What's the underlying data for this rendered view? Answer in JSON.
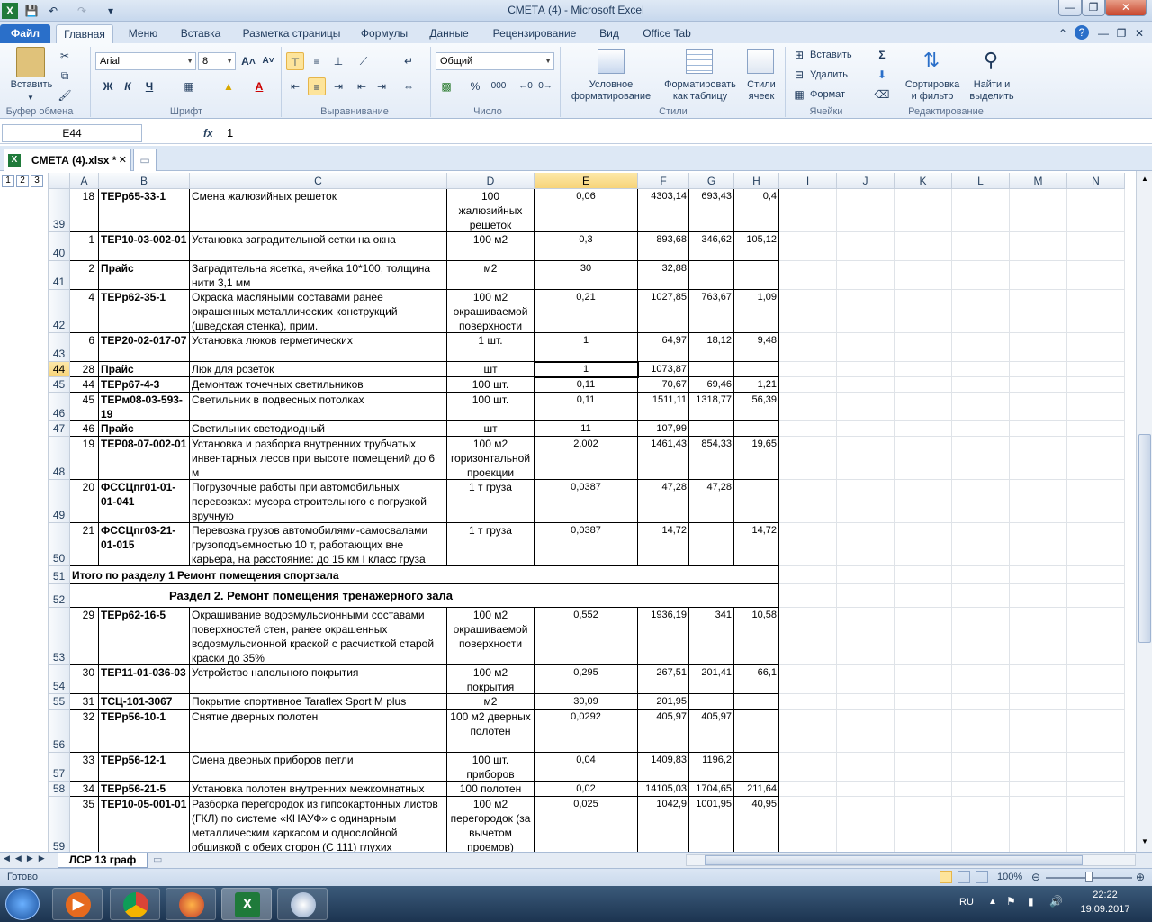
{
  "window": {
    "title": "СМЕТА (4)  -  Microsoft Excel"
  },
  "ribbon_tabs": [
    "Файл",
    "Главная",
    "Меню",
    "Вставка",
    "Разметка страницы",
    "Формулы",
    "Данные",
    "Рецензирование",
    "Вид",
    "Office Tab"
  ],
  "ribbon": {
    "paste_label": "Вставить",
    "font_name": "Arial",
    "font_size": "8",
    "bold": "Ж",
    "italic": "К",
    "underline": "Ч",
    "number_format": "Общий",
    "percent": "%",
    "thousands": "000",
    "conditional_line1": "Условное",
    "conditional_line2": "форматирование",
    "format_table_line1": "Форматировать",
    "format_table_line2": "как таблицу",
    "cell_styles_line1": "Стили",
    "cell_styles_line2": "ячеек",
    "insert": "Вставить",
    "delete": "Удалить",
    "format": "Формат",
    "sort_line1": "Сортировка",
    "sort_line2": "и фильтр",
    "find_line1": "Найти и",
    "find_line2": "выделить",
    "groups": {
      "clipboard": "Буфер обмена",
      "font": "Шрифт",
      "alignment": "Выравнивание",
      "number": "Число",
      "styles": "Стили",
      "cells": "Ячейки",
      "editing": "Редактирование"
    }
  },
  "formula_bar": {
    "cell_ref": "E44",
    "fx": "fx",
    "value": "1"
  },
  "office_tab": {
    "doc_name": "СМЕТА (4).xlsx *"
  },
  "outline_levels": [
    "1",
    "2",
    "3"
  ],
  "columns": [
    "A",
    "B",
    "C",
    "D",
    "E",
    "F",
    "G",
    "H",
    "I",
    "J",
    "K",
    "L",
    "M",
    "N"
  ],
  "rows": [
    {
      "num": "39",
      "a": "18",
      "b": "ТЕРр65-33-1",
      "c": "Смена жалюзийных решеток",
      "d": "100 жалюзийных решеток",
      "e": "0,06",
      "f": "4303,14",
      "g": "693,43",
      "h": "0,4"
    },
    {
      "num": "40",
      "a": "1",
      "b": "ТЕР10-03-002-01",
      "c": "Установка заградительной сетки на окна",
      "d": "100 м2",
      "e": "0,3",
      "f": "893,68",
      "g": "346,62",
      "h": "105,12"
    },
    {
      "num": "41",
      "a": "2",
      "b": "Прайс",
      "c": "Заградительна ясетка, ячейка 10*100, толщина нити 3,1 мм",
      "d": "м2",
      "e": "30",
      "f": "32,88",
      "g": "",
      "h": ""
    },
    {
      "num": "42",
      "a": "4",
      "b": "ТЕРр62-35-1",
      "c": "Окраска масляными составами ранее окрашенных металлических конструкций (шведская стенка), прим.",
      "d": "100 м2 окрашиваемой поверхности",
      "e": "0,21",
      "f": "1027,85",
      "g": "763,67",
      "h": "1,09"
    },
    {
      "num": "43",
      "a": "6",
      "b": "ТЕР20-02-017-07",
      "c": "Установка люков герметических",
      "d": "1 шт.",
      "e": "1",
      "f": "64,97",
      "g": "18,12",
      "h": "9,48"
    },
    {
      "num": "44",
      "a": "28",
      "b": "Прайс",
      "c": "Люк для розеток",
      "d": "шт",
      "e": "1",
      "f": "1073,87",
      "g": "",
      "h": ""
    },
    {
      "num": "45",
      "a": "44",
      "b": "ТЕРр67-4-3",
      "c": "Демонтаж точечных  светильников",
      "d": "100 шт.",
      "e": "0,11",
      "f": "70,67",
      "g": "69,46",
      "h": "1,21"
    },
    {
      "num": "46",
      "a": "45",
      "b": "ТЕРм08-03-593-19",
      "c": "Светильник в подвесных потолках",
      "d": "100 шт.",
      "e": "0,11",
      "f": "1511,11",
      "g": "1318,77",
      "h": "56,39"
    },
    {
      "num": "47",
      "a": "46",
      "b": "Прайс",
      "c": "Светильник светодиодный",
      "d": "шт",
      "e": "11",
      "f": "107,99",
      "g": "",
      "h": ""
    },
    {
      "num": "48",
      "a": "19",
      "b": "ТЕР08-07-002-01",
      "c": "Установка и разборка внутренних трубчатых инвентарных лесов при высоте помещений до 6 м",
      "d": "100 м2 горизонтальной проекции",
      "e": "2,002",
      "f": "1461,43",
      "g": "854,33",
      "h": "19,65"
    },
    {
      "num": "49",
      "a": "20",
      "b": "ФССЦпг01-01-01-041",
      "c": "Погрузочные работы при автомобильных перевозках: мусора строительного с погрузкой вручную",
      "d": "1 т груза",
      "e": "0,0387",
      "f": "47,28",
      "g": "47,28",
      "h": ""
    },
    {
      "num": "50",
      "a": "21",
      "b": "ФССЦпг03-21-01-015",
      "c": "Перевозка грузов автомобилями-самосвалами грузоподъемностью 10 т, работающих вне карьера, на расстояние: до 15 км I класс груза",
      "d": "1 т груза",
      "e": "0,0387",
      "f": "14,72",
      "g": "",
      "h": "14,72"
    },
    {
      "num": "51",
      "section": "Итого по разделу 1 Ремонт помещения спортзала"
    },
    {
      "num": "52",
      "section": "Раздел 2. Ремонт помещения тренажерного зала"
    },
    {
      "num": "53",
      "a": "29",
      "b": "ТЕРр62-16-5",
      "c": "Окрашивание водоэмульсионными составами поверхностей стен, ранее окрашенных водоэмульсионной краской с расчисткой старой краски до 35%",
      "d": "100 м2 окрашиваемой поверхности",
      "e": "0,552",
      "f": "1936,19",
      "g": "341",
      "h": "10,58"
    },
    {
      "num": "54",
      "a": "30",
      "b": "ТЕР11-01-036-03",
      "c": "Устройство напольного покрытия",
      "d": "100 м2 покрытия",
      "e": "0,295",
      "f": "267,51",
      "g": "201,41",
      "h": "66,1"
    },
    {
      "num": "55",
      "a": "31",
      "b": "ТСЦ-101-3067",
      "c": "Покрытие спортивное Taraflex Sport M plus",
      "d": "м2",
      "e": "30,09",
      "f": "201,95",
      "g": "",
      "h": ""
    },
    {
      "num": "56",
      "a": "32",
      "b": "ТЕРр56-10-1",
      "c": "Снятие дверных полотен",
      "d": "100 м2 дверных полотен",
      "e": "0,0292",
      "f": "405,97",
      "g": "405,97",
      "h": ""
    },
    {
      "num": "57",
      "a": "33",
      "b": "ТЕРр56-12-1",
      "c": "Смена дверных приборов петли",
      "d": "100 шт. приборов",
      "e": "0,04",
      "f": "1409,83",
      "g": "1196,2",
      "h": ""
    },
    {
      "num": "58",
      "a": "34",
      "b": "ТЕРр56-21-5",
      "c": "Установка полотен внутренних межкомнатных",
      "d": "100 полотен",
      "e": "0,02",
      "f": "14105,03",
      "g": "1704,65",
      "h": "211,64"
    },
    {
      "num": "59",
      "a": "35",
      "b": "ТЕР10-05-001-01",
      "c": "Разборка перегородок из гипсокартонных листов (ГКЛ) по системе «КНАУФ» с одинарным металлическим каркасом и однослойной обшивкой с обеих сторон (С 111) глухих",
      "d": "100 м2 перегородок (за вычетом проемов)",
      "e": "0,025",
      "f": "1042,9",
      "g": "1001,95",
      "h": "40,95"
    }
  ],
  "sheet_tab": "ЛСР 13 граф",
  "status": {
    "ready": "Готово",
    "zoom": "100%"
  },
  "taskbar": {
    "lang": "RU",
    "time": "22:22",
    "date": "19.09.2017"
  }
}
